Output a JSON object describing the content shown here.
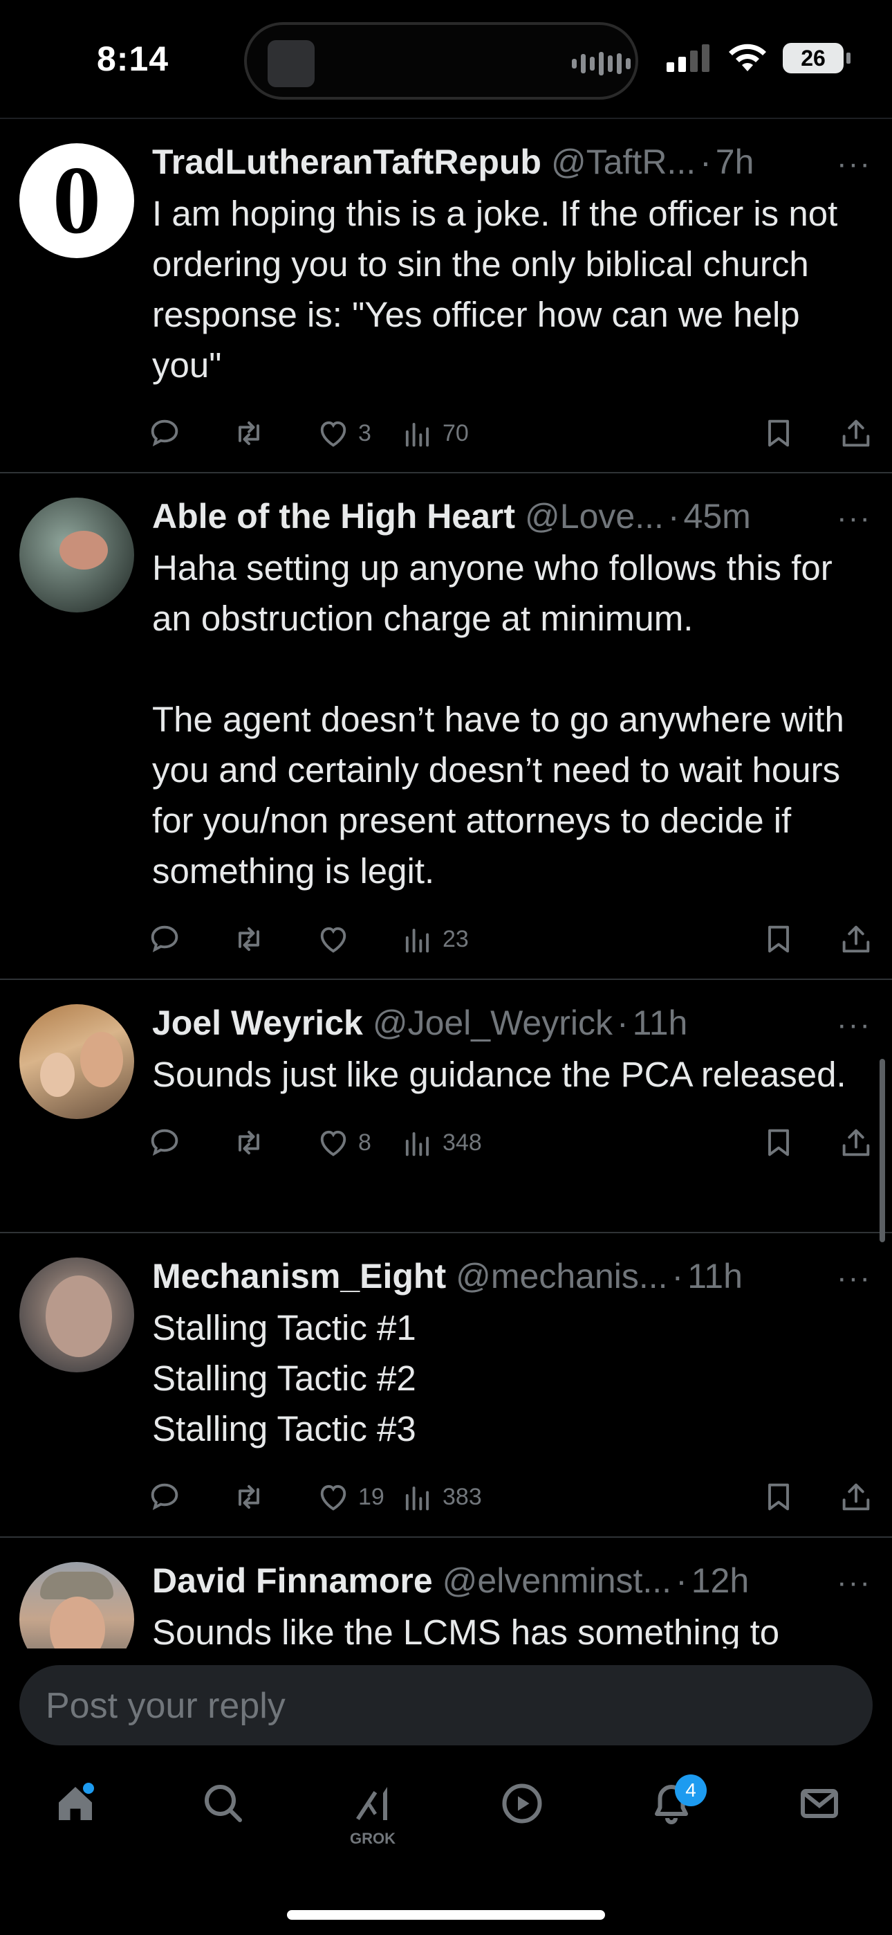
{
  "status": {
    "time": "8:14",
    "battery": "26"
  },
  "replies": [
    {
      "name": "TradLutheranTaftRepub",
      "handle": "@TaftR...",
      "time": "7h",
      "text": "I am hoping this is a joke. If the officer is not ordering you to sin the only biblical church response is: \"Yes officer how can we help you\"",
      "likes": "3",
      "views": "70",
      "avatar_letter": "0"
    },
    {
      "name": "Able of the High Heart",
      "handle": "@Love...",
      "time": "45m",
      "text": "Haha setting up anyone who follows this for an obstruction charge at minimum.\n\nThe agent doesn’t have to go anywhere with you and certainly doesn’t need to wait hours for you/non present attorneys to decide if something is legit.",
      "likes": "",
      "views": "23"
    },
    {
      "name": "Joel Weyrick",
      "handle": "@Joel_Weyrick",
      "time": "11h",
      "text": "Sounds just like guidance the PCA released.",
      "likes": "8",
      "views": "348"
    },
    {
      "name": "Mechanism_Eight",
      "handle": "@mechanis...",
      "time": "11h",
      "text": "Stalling Tactic #1\nStalling Tactic #2\nStalling Tactic #3",
      "likes": "19",
      "views": "383"
    },
    {
      "name": "David Finnamore",
      "handle": "@elvenminst...",
      "time": "12h",
      "text": "Sounds like the LCMS has something to",
      "likes": "",
      "views": ""
    }
  ],
  "reply_box": {
    "placeholder": "Post your reply"
  },
  "nav": {
    "grok_label": "GROK",
    "notifications_badge": "4"
  },
  "colors": {
    "background": "#000000",
    "text": "#e7e9ea",
    "muted": "#71767b",
    "accent": "#1d9bf0"
  }
}
